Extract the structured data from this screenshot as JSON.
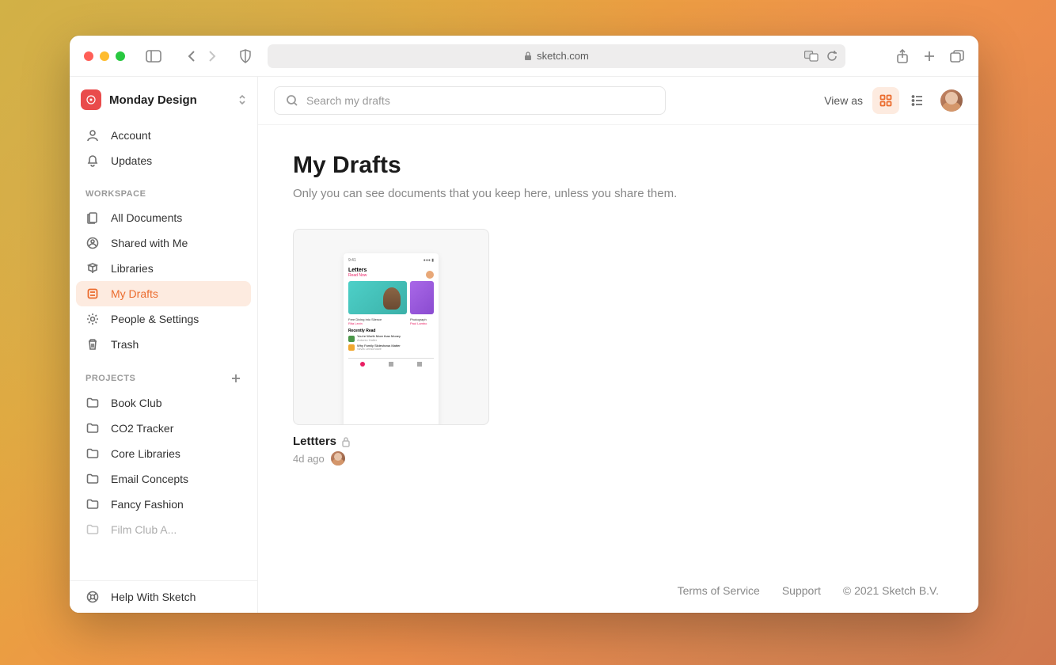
{
  "browser": {
    "url_host": "sketch.com"
  },
  "workspace": {
    "name": "Monday Design"
  },
  "sidebar": {
    "account": [
      {
        "label": "Account"
      },
      {
        "label": "Updates"
      }
    ],
    "workspace_header": "WORKSPACE",
    "workspace_items": [
      {
        "label": "All Documents"
      },
      {
        "label": "Shared with Me"
      },
      {
        "label": "Libraries"
      },
      {
        "label": "My Drafts"
      },
      {
        "label": "People & Settings"
      },
      {
        "label": "Trash"
      }
    ],
    "projects_header": "PROJECTS",
    "projects": [
      {
        "label": "Book Club"
      },
      {
        "label": "CO2 Tracker"
      },
      {
        "label": "Core Libraries"
      },
      {
        "label": "Email Concepts"
      },
      {
        "label": "Fancy Fashion"
      },
      {
        "label": "Film Club A..."
      }
    ],
    "help": "Help With Sketch"
  },
  "header": {
    "search_placeholder": "Search my drafts",
    "view_as": "View as"
  },
  "page": {
    "title": "My Drafts",
    "subtitle": "Only you can see documents that you keep here, unless you share them."
  },
  "documents": [
    {
      "title": "Lettters",
      "time": "4d ago"
    }
  ],
  "mock": {
    "time": "9:41",
    "title": "Letters",
    "sub": "Read Now",
    "cap1": "Free Diving into Silence",
    "auth1": "Rita Levin",
    "cap2": "Photograph",
    "auth2": "Paul Lambo",
    "section": "Recently Read",
    "li1": "You're Worth More than Money",
    "la1": "Antonio Haller",
    "li2": "Why Family Slideshows Matter",
    "la2": "Silvia Lenschowe"
  },
  "footer": {
    "tos": "Terms of Service",
    "support": "Support",
    "copyright": "© 2021 Sketch B.V."
  }
}
